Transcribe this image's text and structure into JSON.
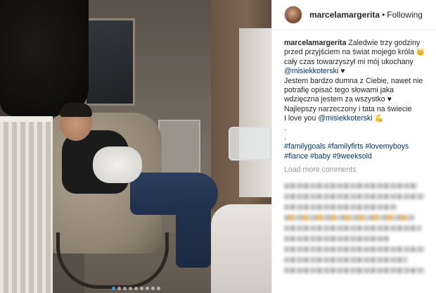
{
  "post": {
    "username": "marcelamargerita",
    "separator": "•",
    "follow_state": "Following"
  },
  "caption": {
    "user": "marcelamargerita",
    "line1": "Zaledwie trzy godziny przed przyjściem na świat mojego króla",
    "crown_emoji": "👑",
    "line2": "cały czas towarzyszył mi mój ukochany",
    "mention1": "@misiekkoterski",
    "heart": "♥",
    "line3": "Jestem bardzo dumna z Ciebie, nawet nie potrafię opisać tego słowami jaka wdzięczna jestem za wszystko",
    "line4": "Najlepszy narzeczony i tata na świecie",
    "line5": "I love you",
    "mention2": "@misiekkoterski",
    "muscle_emoji": "💪",
    "dot1": ".",
    "dot2": ".",
    "hashtags_line1": "#familygoals #familyfirts #lovemyboys",
    "hashtags_line2": "#fiance #baby #9weeksold"
  },
  "comments": {
    "load_more_label": "Load more comments"
  },
  "carousel": {
    "count": 9,
    "active_index": 0
  },
  "colors": {
    "link": "#003569",
    "text": "#262626",
    "muted": "#999999",
    "accent": "#3897f0"
  }
}
